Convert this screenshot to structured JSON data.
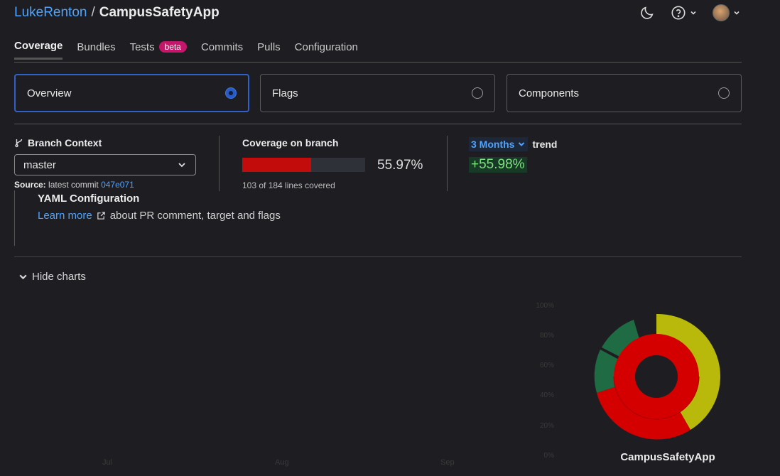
{
  "header": {
    "owner": "LukeRenton",
    "separator": "/",
    "repo": "CampusSafetyApp",
    "icons": [
      "moon-icon",
      "help-icon",
      "chevron-down-icon",
      "avatar"
    ]
  },
  "tabs": [
    {
      "label": "Coverage",
      "active": true
    },
    {
      "label": "Bundles"
    },
    {
      "label": "Tests",
      "badge": "beta"
    },
    {
      "label": "Commits"
    },
    {
      "label": "Pulls"
    },
    {
      "label": "Configuration"
    }
  ],
  "cards": [
    {
      "label": "Overview",
      "selected": true
    },
    {
      "label": "Flags",
      "selected": false
    },
    {
      "label": "Components",
      "selected": false
    }
  ],
  "branch": {
    "title": "Branch Context",
    "selected": "master",
    "source_label": "Source:",
    "source_text": "latest commit",
    "commit": "047e071"
  },
  "coverage": {
    "title": "Coverage on branch",
    "percent_text": "55.97%",
    "fraction": 0.5597,
    "lines_text": "103 of 184 lines covered"
  },
  "trend": {
    "range": "3 Months",
    "label": "trend",
    "value": "+55.98%"
  },
  "yaml": {
    "title": "YAML Configuration",
    "link": "Learn more",
    "text": "about PR comment, target and flags"
  },
  "charts": {
    "toggle_label": "Hide charts",
    "y_ticks": [
      "100%",
      "80%",
      "60%",
      "40%",
      "20%",
      "0%"
    ],
    "x_ticks": [
      "Jul",
      "Aug",
      "Sep"
    ],
    "sunburst_title": "CampusSafetyApp",
    "colors": {
      "red": "#d40000",
      "yellow": "#b9b90c",
      "green": "#1f6b43"
    }
  }
}
